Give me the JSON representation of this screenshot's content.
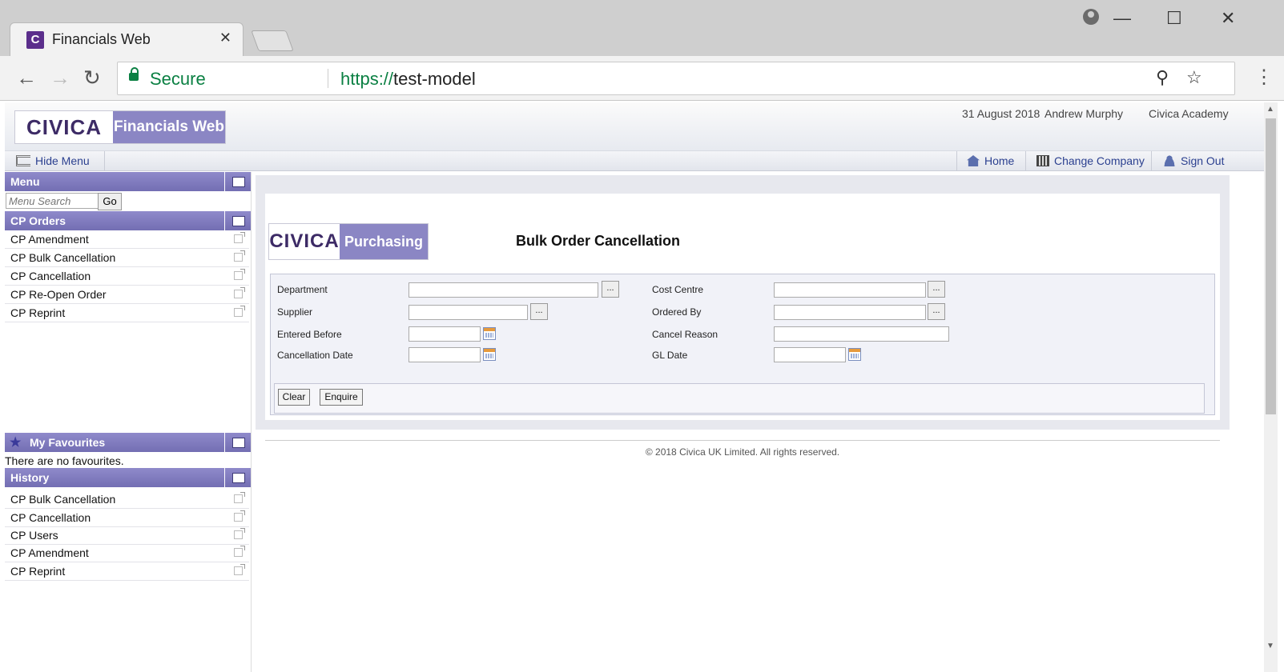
{
  "browser": {
    "tab_title": "Financials Web",
    "tab_favicon_letter": "C",
    "tab_close": "✕",
    "secure_label": "Secure",
    "url_protocol": "https://",
    "url_host": "test-model",
    "win_min": "—",
    "win_max": "☐",
    "win_close": "✕"
  },
  "header": {
    "logo_brand": "CIVICA",
    "logo_app": "Financials Web",
    "date": "31 August 2018",
    "user": "Andrew Murphy",
    "company": "Civica Academy"
  },
  "navbar": {
    "hide_menu": "Hide Menu",
    "home": "Home",
    "change_company": "Change Company",
    "sign_out": "Sign Out"
  },
  "sidebar": {
    "menu_title": "Menu",
    "search_placeholder": "Menu Search",
    "go_label": "Go",
    "cp_orders_title": "CP Orders",
    "cp_orders_items": [
      "CP Amendment",
      "CP Bulk Cancellation",
      "CP Cancellation",
      "CP Re-Open Order",
      "CP Reprint"
    ],
    "favourites_title": "My Favourites",
    "favourites_empty": "There are no favourites.",
    "history_title": "History",
    "history_items": [
      "CP Bulk Cancellation",
      "CP Cancellation",
      "CP Users",
      "CP Amendment",
      "CP Reprint"
    ]
  },
  "content": {
    "module_brand": "CIVICA",
    "module_app": "Purchasing",
    "page_title": "Bulk Order Cancellation",
    "fields": {
      "department": "Department",
      "supplier": "Supplier",
      "entered_before": "Entered Before",
      "cancellation_date": "Cancellation Date",
      "cost_centre": "Cost Centre",
      "ordered_by": "Ordered By",
      "cancel_reason": "Cancel Reason",
      "gl_date": "GL Date"
    },
    "lookup_label": "...",
    "clear_label": "Clear",
    "enquire_label": "Enquire"
  },
  "footer": {
    "copyright": "© 2018 Civica UK Limited. All rights reserved."
  },
  "colors": {
    "accent": "#8b86c4",
    "panel_header": "#736eb3",
    "link": "#2a3f8f",
    "secure": "#0b8043"
  }
}
